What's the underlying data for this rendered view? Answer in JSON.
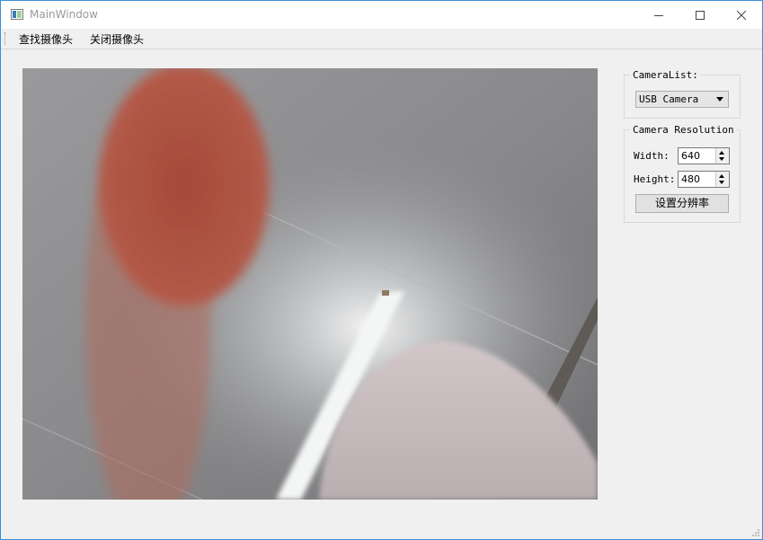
{
  "window": {
    "title": "MainWindow"
  },
  "menu": {
    "items": [
      {
        "label": "查找摄像头"
      },
      {
        "label": "关闭摄像头"
      }
    ]
  },
  "camera_list": {
    "title": "CameraList:",
    "selected": "USB Camera"
  },
  "resolution": {
    "title": "Camera Resolution",
    "width_label": "Width:",
    "width_value": "640",
    "height_label": "Height:",
    "height_value": "480",
    "set_button": "设置分辨率"
  },
  "colors": {
    "window_border": "#3a8fd6",
    "background": "#f0f0f0",
    "title_text": "#999999"
  },
  "icons": [
    "app-icon",
    "minimize-icon",
    "maximize-icon",
    "close-icon",
    "dropdown-arrow-icon",
    "spin-up-icon",
    "spin-down-icon",
    "size-grip-icon"
  ]
}
